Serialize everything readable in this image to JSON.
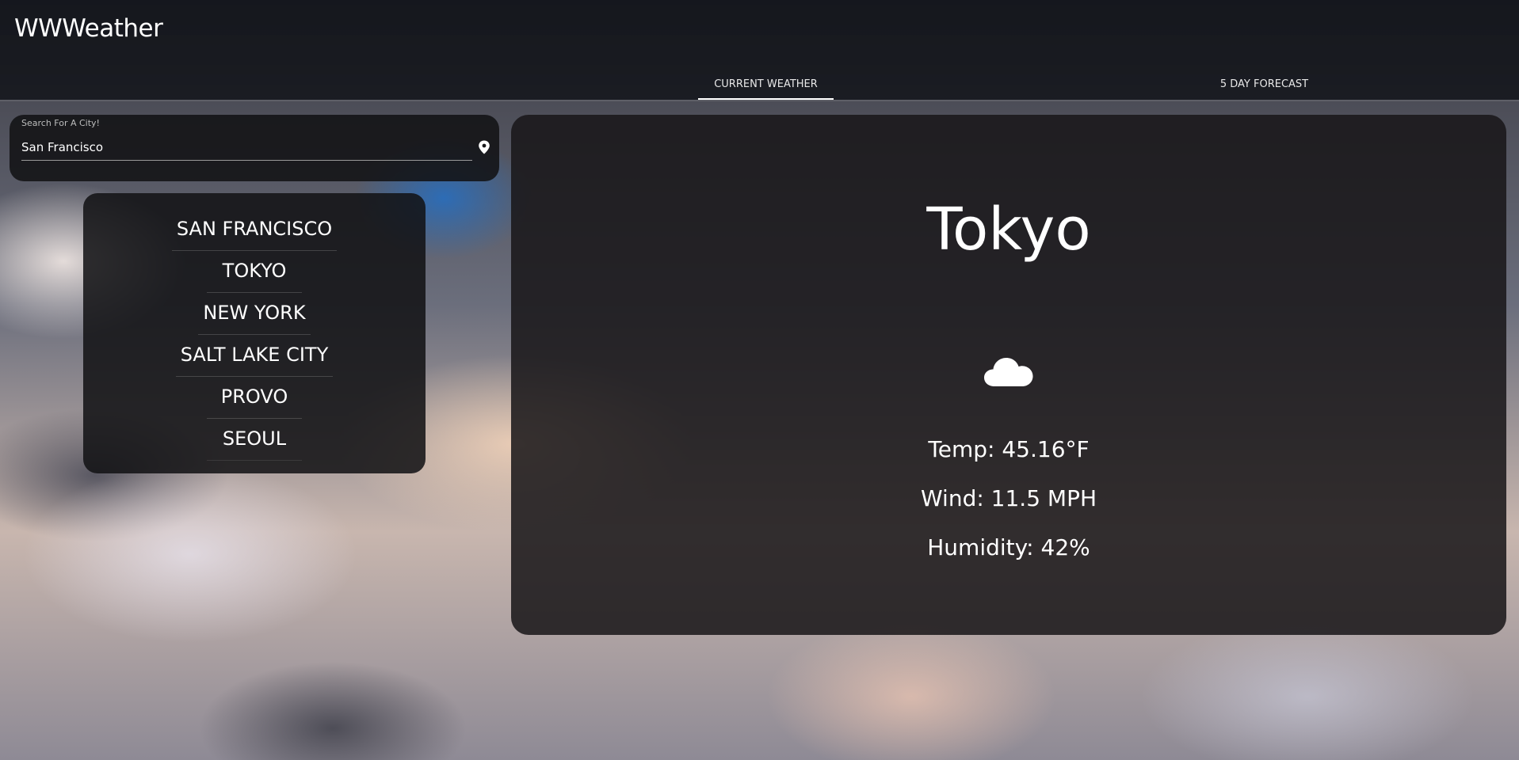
{
  "header": {
    "app_title": "WWWeather",
    "tabs": [
      {
        "label": "CURRENT WEATHER",
        "active": true
      },
      {
        "label": "5 DAY FORECAST",
        "active": false
      }
    ]
  },
  "search": {
    "label": "Search For A City!",
    "value": "San Francisco",
    "icon": "map-pin-icon"
  },
  "saved_cities": [
    "SAN FRANCISCO",
    "TOKYO",
    "NEW YORK",
    "SALT LAKE CITY",
    "PROVO",
    "SEOUL"
  ],
  "current_weather": {
    "city": "Tokyo",
    "condition_icon": "cloud-icon",
    "temp": "Temp: 45.16°F",
    "wind": "Wind: 11.5 MPH",
    "humidity": "Humidity: 42%"
  }
}
